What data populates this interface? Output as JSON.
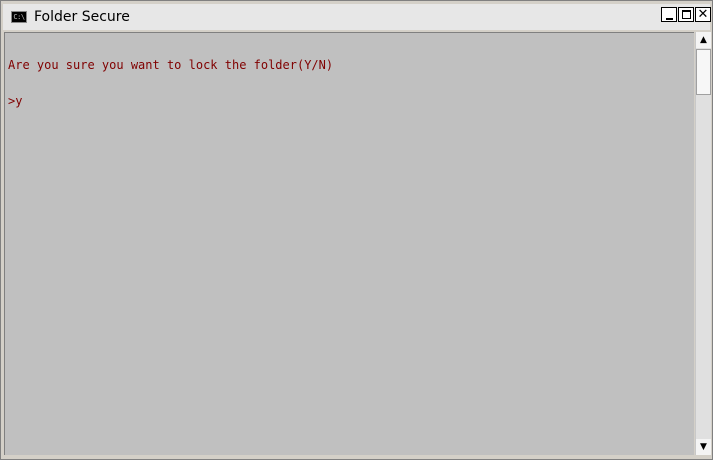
{
  "window": {
    "title": "Folder Secure",
    "icon": "console-icon",
    "icon_text": "C:\\"
  },
  "controls": {
    "minimize": "minimize-icon",
    "maximize": "maximize-icon",
    "close": "close-icon",
    "close_glyph": "✕"
  },
  "console": {
    "lines": [
      "Are you sure you want to lock the folder(Y/N)",
      ">y"
    ],
    "text_color": "#800000",
    "background": "#c0c0c0"
  },
  "scrollbar": {
    "up_arrow": "▲",
    "down_arrow": "▼"
  }
}
